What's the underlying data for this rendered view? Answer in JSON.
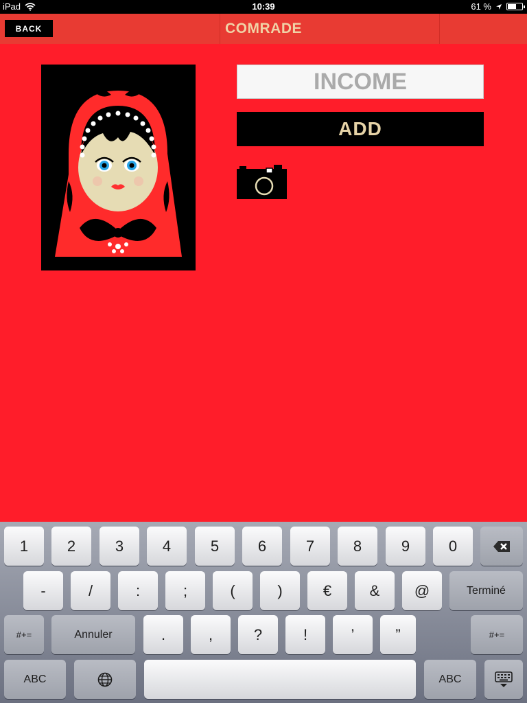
{
  "status": {
    "device": "iPad",
    "time": "10:39",
    "battery_text": "61 %",
    "battery_level": 0.61
  },
  "nav": {
    "back_label": "BACK",
    "title": "COMRADE"
  },
  "form": {
    "income_placeholder": "INCOME",
    "add_label": "ADD"
  },
  "icons": {
    "camera": "camera-icon",
    "wifi": "wifi-icon",
    "location": "location-arrow-icon",
    "backspace": "backspace-icon",
    "globe": "globe-icon",
    "dismiss": "keyboard-dismiss-icon"
  },
  "colors": {
    "background": "#ff1d2a",
    "nav": "#e83b33",
    "title": "#f0d2a6",
    "add_text": "#e6d3a7"
  },
  "keyboard": {
    "row1": [
      "1",
      "2",
      "3",
      "4",
      "5",
      "6",
      "7",
      "8",
      "9",
      "0"
    ],
    "row2": [
      "-",
      "/",
      ":",
      ";",
      "(",
      ")",
      "€",
      "&",
      "@"
    ],
    "row2_done": "Terminé",
    "row3_left": "#+=",
    "row3_cancel": "Annuler",
    "row3": [
      ".",
      ",",
      "?",
      "!",
      "’",
      "”"
    ],
    "row3_right": "#+=",
    "row4_left": "ABC",
    "row4_right": "ABC"
  }
}
